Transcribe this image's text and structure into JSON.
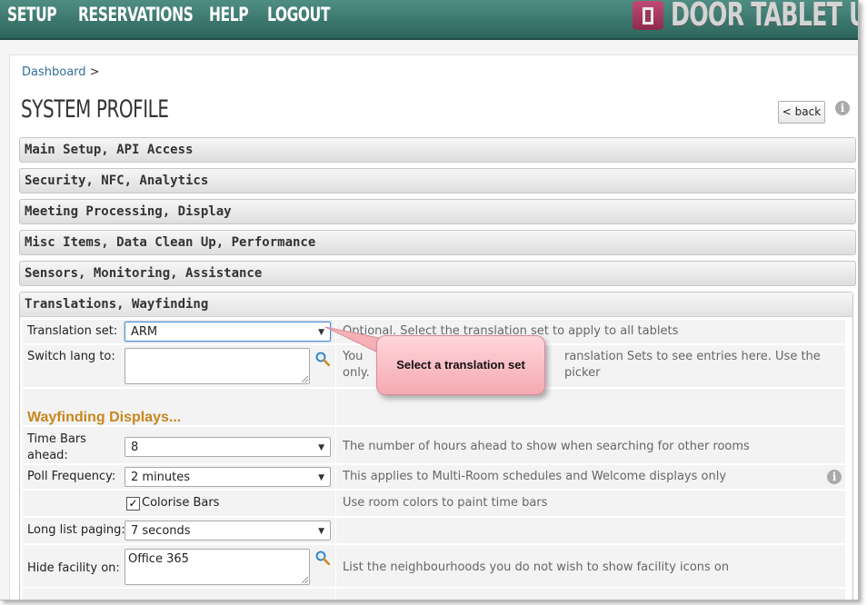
{
  "nav": {
    "items": [
      "SETUP",
      "RESERVATIONS",
      "HELP",
      "LOGOUT"
    ],
    "logo_text": "DOOR TABLET U"
  },
  "breadcrumb": {
    "link": "Dashboard",
    "separator": ">"
  },
  "page_title": "SYSTEM PROFILE",
  "back_label": "< back",
  "info_glyph": "i",
  "sections": [
    "Main Setup, API Access",
    "Security, NFC, Analytics",
    "Meeting Processing, Display",
    "Misc Items, Data Clean Up, Performance",
    "Sensors, Monitoring, Assistance"
  ],
  "open_section": {
    "title": "Translations, Wayfinding",
    "translation_set": {
      "label": "Translation set:",
      "value": "ARM",
      "desc": "Optional. Select the translation set to apply to all tablets"
    },
    "switch_lang": {
      "label": "Switch lang to:",
      "value": "",
      "desc_line1": "You",
      "desc_line1b": "ranslation Sets to see entries here.  Use the picker",
      "desc_line2": "only."
    },
    "wayfinding_heading": "Wayfinding Displays...",
    "time_bars": {
      "label_line1": "Time Bars",
      "label_line2": "ahead:",
      "value": "8",
      "desc": "The number of hours ahead to show when searching for other rooms"
    },
    "poll_frequency": {
      "label": "Poll Frequency:",
      "value": "2 minutes",
      "desc": "This applies to Multi-Room schedules and Welcome displays only"
    },
    "colorise_bars": {
      "label": "Colorise Bars",
      "checked": true,
      "desc": "Use room colors to paint time bars"
    },
    "long_list_paging": {
      "label": "Long list paging:",
      "value": "7 seconds"
    },
    "hide_facility": {
      "label": "Hide facility on:",
      "value": "Office 365",
      "desc": "List the neighbourhoods you do not wish to show facility icons on"
    }
  },
  "callout": "Select a translation set",
  "colors": {
    "nav_bg": "#3b786e",
    "heading_orange": "#c8861e",
    "link_blue": "#2f6e9c",
    "callout_pink": "#f7b6be"
  }
}
